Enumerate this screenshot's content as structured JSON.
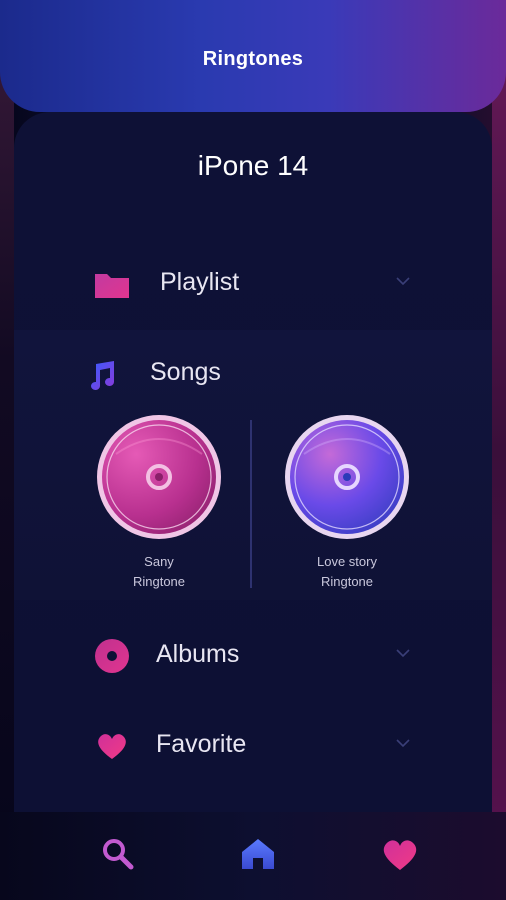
{
  "header": {
    "title": "Ringtones"
  },
  "device": {
    "name": "iPone 14"
  },
  "menu": {
    "playlist": {
      "label": "Playlist"
    },
    "songs": {
      "label": "Songs"
    },
    "albums": {
      "label": "Albums"
    },
    "favorite": {
      "label": "Favorite"
    }
  },
  "songs": [
    {
      "title": "Sany",
      "subtitle": "Ringtone"
    },
    {
      "title": "Love story",
      "subtitle": "Ringtone"
    }
  ],
  "nav": {
    "items": [
      {
        "icon": "search-icon"
      },
      {
        "icon": "home-icon"
      },
      {
        "icon": "heart-icon"
      }
    ]
  },
  "colors": {
    "header_start": "#1b2a8c",
    "header_end": "#6b2a9a",
    "pink_accent": "#e0358f",
    "blue_accent": "#4a6cff",
    "purple_accent": "#7a3ad0"
  }
}
